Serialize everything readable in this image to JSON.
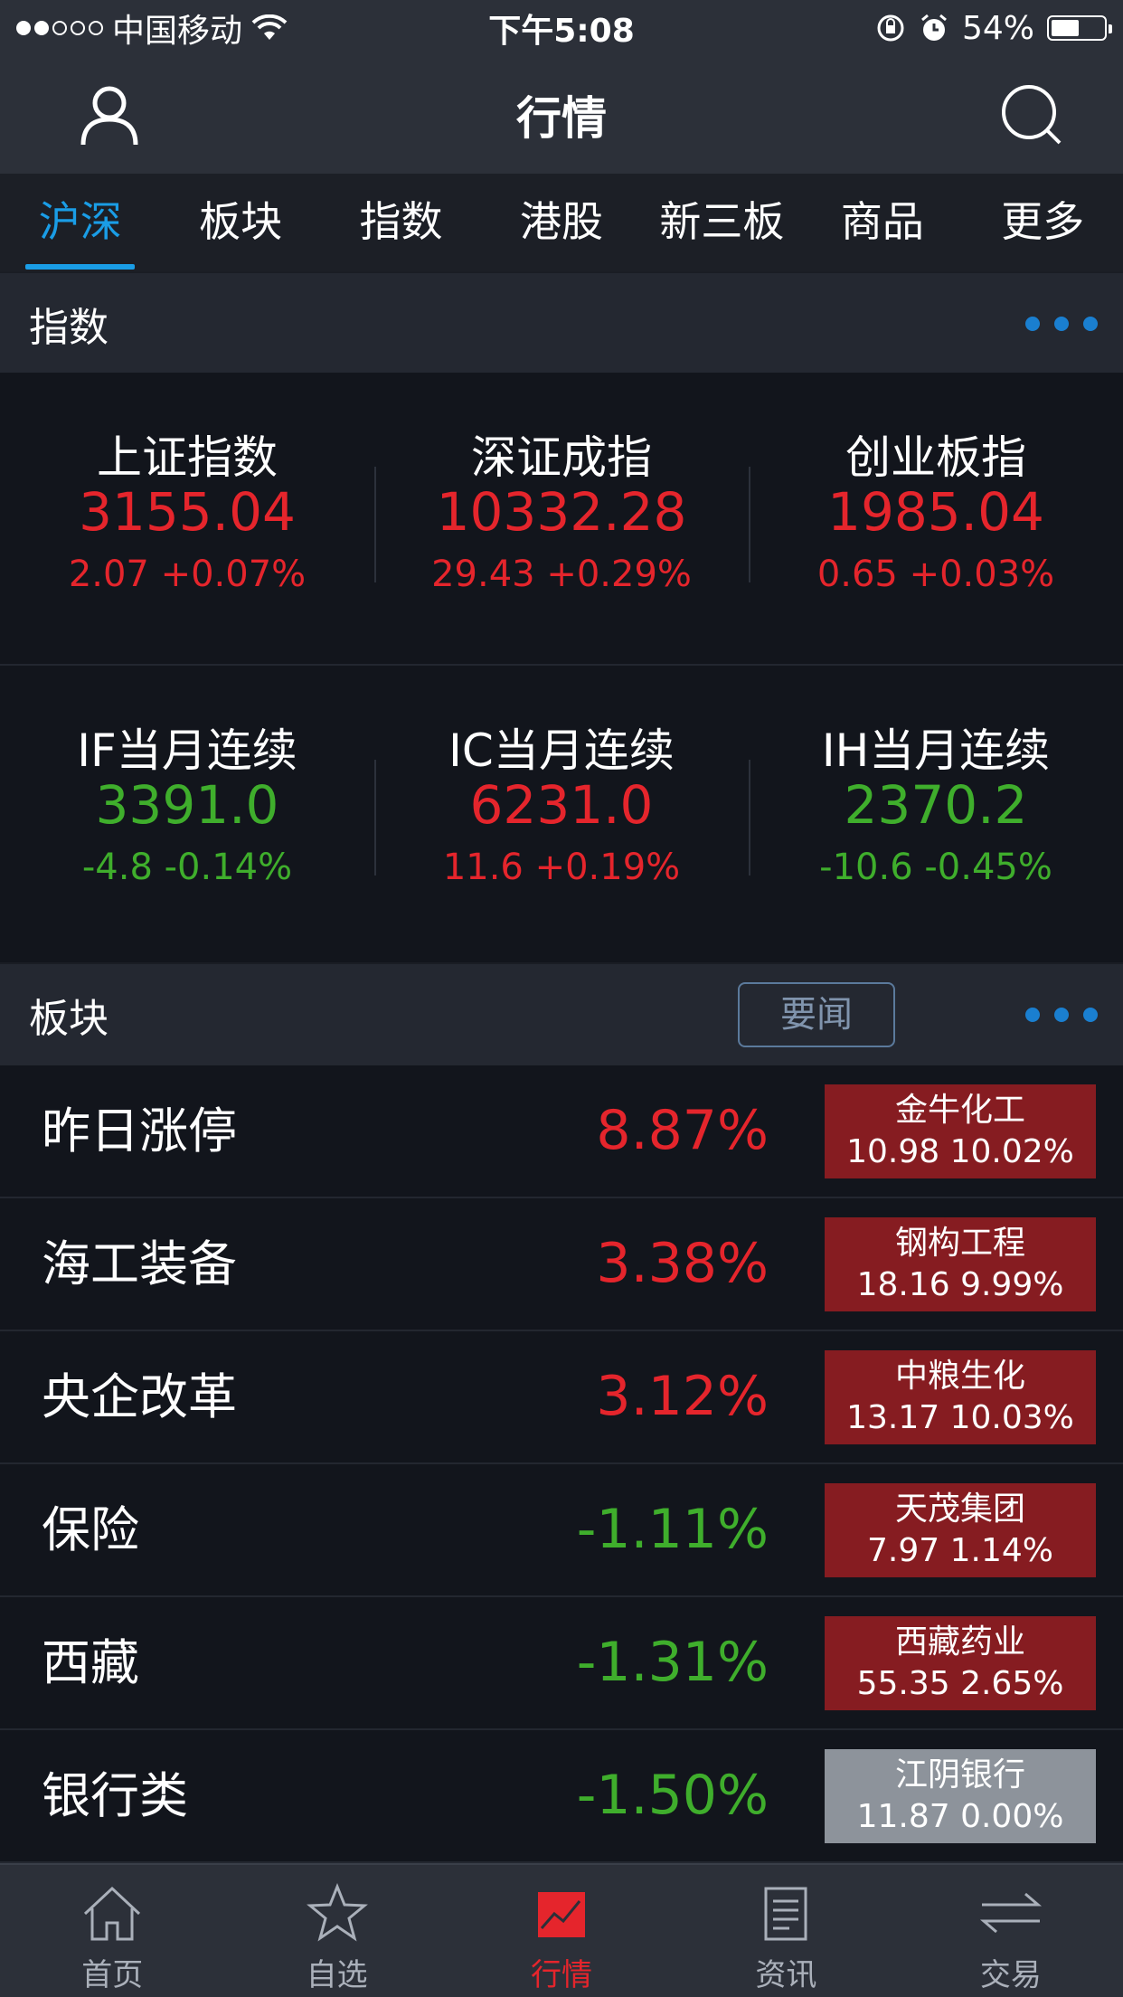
{
  "status_bar": {
    "carrier": "中国移动",
    "time": "下午5:08",
    "battery": "54%",
    "battery_level": 0.54
  },
  "header": {
    "title": "行情"
  },
  "tabs": [
    {
      "label": "沪深",
      "active": true
    },
    {
      "label": "板块",
      "active": false
    },
    {
      "label": "指数",
      "active": false
    },
    {
      "label": "港股",
      "active": false
    },
    {
      "label": "新三板",
      "active": false
    },
    {
      "label": "商品",
      "active": false
    },
    {
      "label": "更多",
      "active": false
    }
  ],
  "index_section": {
    "title": "指数",
    "items": [
      {
        "name": "上证指数",
        "value": "3155.04",
        "change": "2.07 +0.07%",
        "trend": "up"
      },
      {
        "name": "深证成指",
        "value": "10332.28",
        "change": "29.43 +0.29%",
        "trend": "up"
      },
      {
        "name": "创业板指",
        "value": "1985.04",
        "change": "0.65 +0.03%",
        "trend": "up"
      },
      {
        "name": "IF当月连续",
        "value": "3391.0",
        "change": "-4.8 -0.14%",
        "trend": "down"
      },
      {
        "name": "IC当月连续",
        "value": "6231.0",
        "change": "11.6 +0.19%",
        "trend": "up"
      },
      {
        "name": "IH当月连续",
        "value": "2370.2",
        "change": "-10.6 -0.45%",
        "trend": "down"
      }
    ]
  },
  "sector_section": {
    "title": "板块",
    "news_button": "要闻",
    "rows": [
      {
        "name": "昨日涨停",
        "pct": "8.87%",
        "trend": "up",
        "leader_name": "金牛化工",
        "leader_value": "10.98 10.02%",
        "leader_trend": "up"
      },
      {
        "name": "海工装备",
        "pct": "3.38%",
        "trend": "up",
        "leader_name": "钢构工程",
        "leader_value": "18.16 9.99%",
        "leader_trend": "up"
      },
      {
        "name": "央企改革",
        "pct": "3.12%",
        "trend": "up",
        "leader_name": "中粮生化",
        "leader_value": "13.17 10.03%",
        "leader_trend": "up"
      },
      {
        "name": "保险",
        "pct": "-1.11%",
        "trend": "down",
        "leader_name": "天茂集团",
        "leader_value": "7.97 1.14%",
        "leader_trend": "up"
      },
      {
        "name": "西藏",
        "pct": "-1.31%",
        "trend": "down",
        "leader_name": "西藏药业",
        "leader_value": "55.35 2.65%",
        "leader_trend": "up"
      },
      {
        "name": "银行类",
        "pct": "-1.50%",
        "trend": "down",
        "leader_name": "江阴银行",
        "leader_value": "11.87 0.00%",
        "leader_trend": "flat"
      }
    ]
  },
  "tab_bar": [
    {
      "label": "首页",
      "icon": "home-icon",
      "active": false
    },
    {
      "label": "自选",
      "icon": "star-icon",
      "active": false
    },
    {
      "label": "行情",
      "icon": "chart-icon",
      "active": true
    },
    {
      "label": "资讯",
      "icon": "news-icon",
      "active": false
    },
    {
      "label": "交易",
      "icon": "trade-icon",
      "active": false
    }
  ],
  "colors": {
    "up": "#e5252c",
    "down": "#3fae2c",
    "accent": "#1a9de6"
  }
}
